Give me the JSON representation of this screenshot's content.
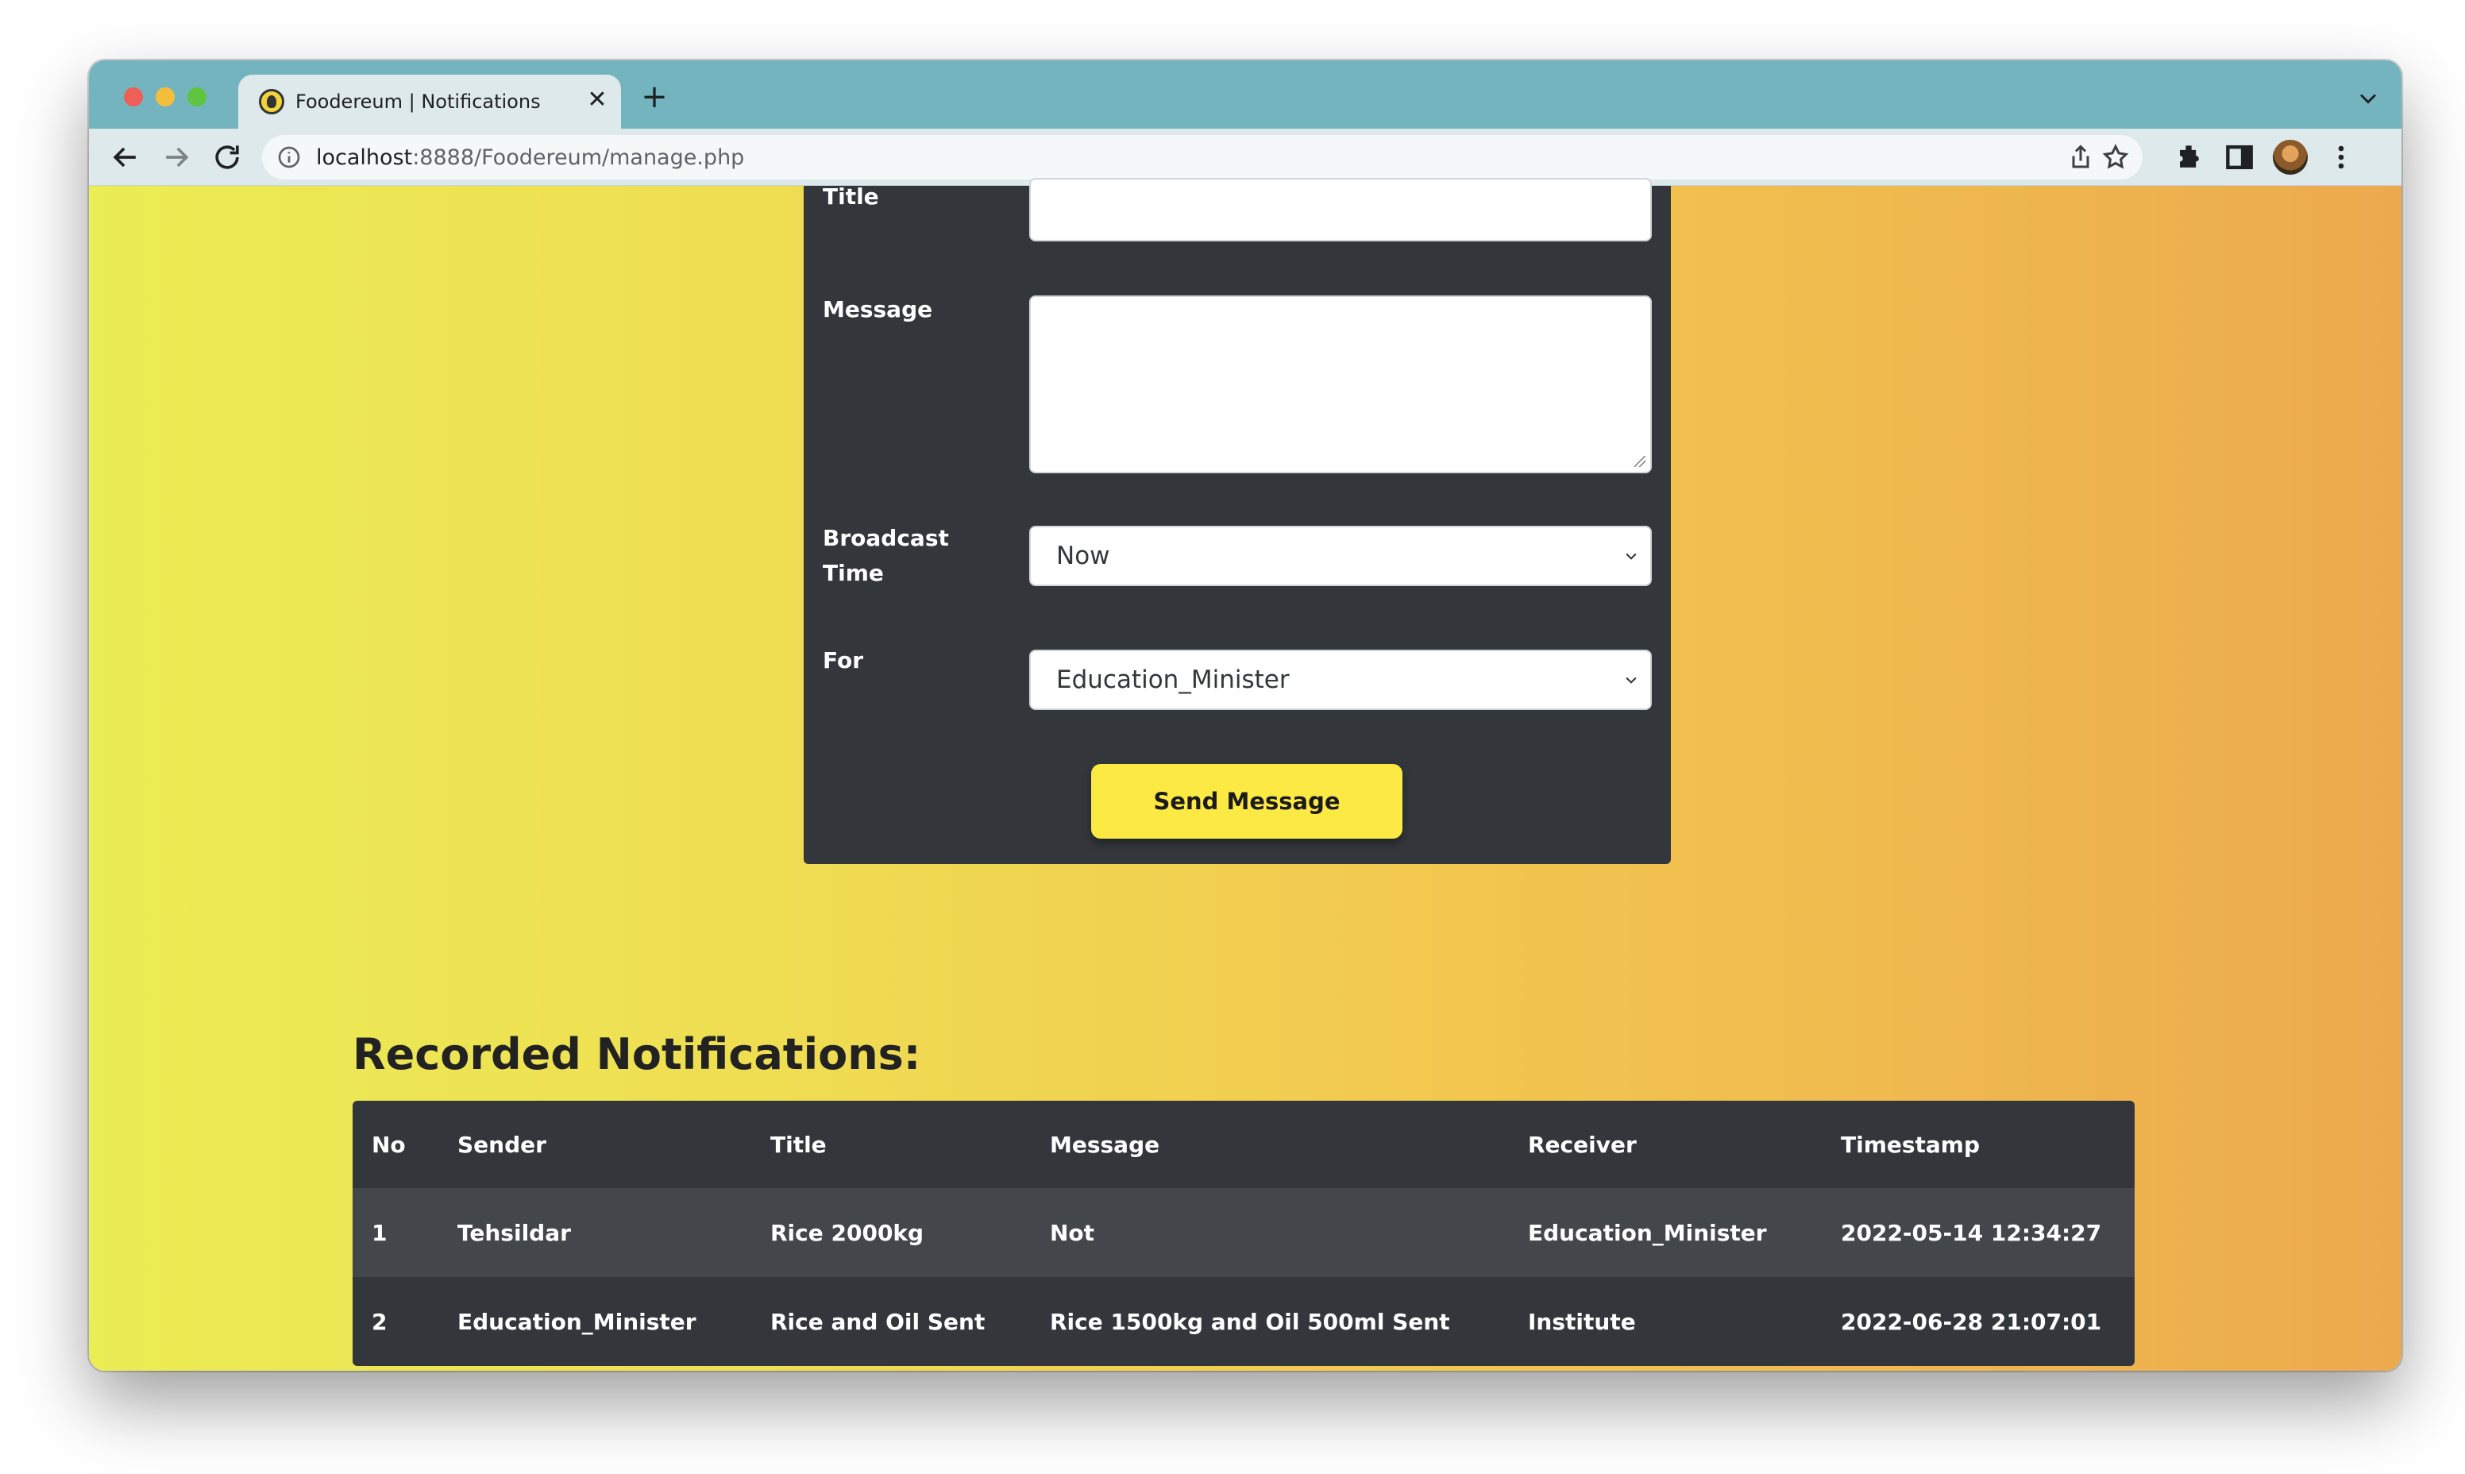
{
  "browser": {
    "tab_title": "Foodereum | Notifications",
    "tab_close": "✕",
    "new_tab": "+",
    "url_host": "localhost",
    "url_rest": ":8888/Foodereum/manage.php"
  },
  "form": {
    "title_label": "Title",
    "message_label": "Message",
    "broadcast_label": "Broadcast Time",
    "for_label": "For",
    "title_value": "",
    "message_value": "",
    "broadcast_value": "Now",
    "for_value": "Education_Minister",
    "send_label": "Send Message"
  },
  "notifications": {
    "heading": "Recorded Notifications:",
    "columns": {
      "no": "No",
      "sender": "Sender",
      "title": "Title",
      "message": "Message",
      "receiver": "Receiver",
      "timestamp": "Timestamp"
    },
    "rows": [
      {
        "no": "1",
        "sender": "Tehsildar",
        "title": "Rice 2000kg",
        "message": "Not",
        "receiver": "Education_Minister",
        "timestamp": "2022-05-14 12:34:27"
      },
      {
        "no": "2",
        "sender": "Education_Minister",
        "title": "Rice and Oil Sent",
        "message": "Rice 1500kg and Oil 500ml Sent",
        "receiver": "Institute",
        "timestamp": "2022-06-28 21:07:01"
      }
    ]
  },
  "colors": {
    "panel": "#33373b",
    "button": "#fce944",
    "chrome_tabstrip": "#73b4be"
  }
}
